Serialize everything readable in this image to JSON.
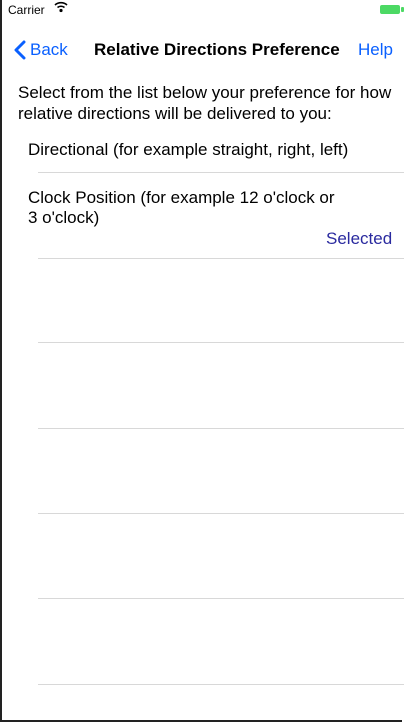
{
  "status_bar": {
    "carrier": "Carrier",
    "wifi_icon": "wifi-icon",
    "battery_icon": "battery-icon"
  },
  "nav": {
    "back_label": "Back",
    "back_icon": "chevron-left-icon",
    "title": "Relative Directions Preference",
    "help_label": "Help"
  },
  "intro_text": "Select from the list below your preference for how relative directions will be delivered to you:",
  "options": [
    {
      "label": "Directional  (for example straight, right, left)"
    },
    {
      "label": "Clock Position  (for example 12 o'clock or 3 o'clock)",
      "status": "Selected"
    }
  ],
  "colors": {
    "link": "#0a60ff",
    "selected": "#2a2a9f",
    "battery": "#4cd964"
  }
}
